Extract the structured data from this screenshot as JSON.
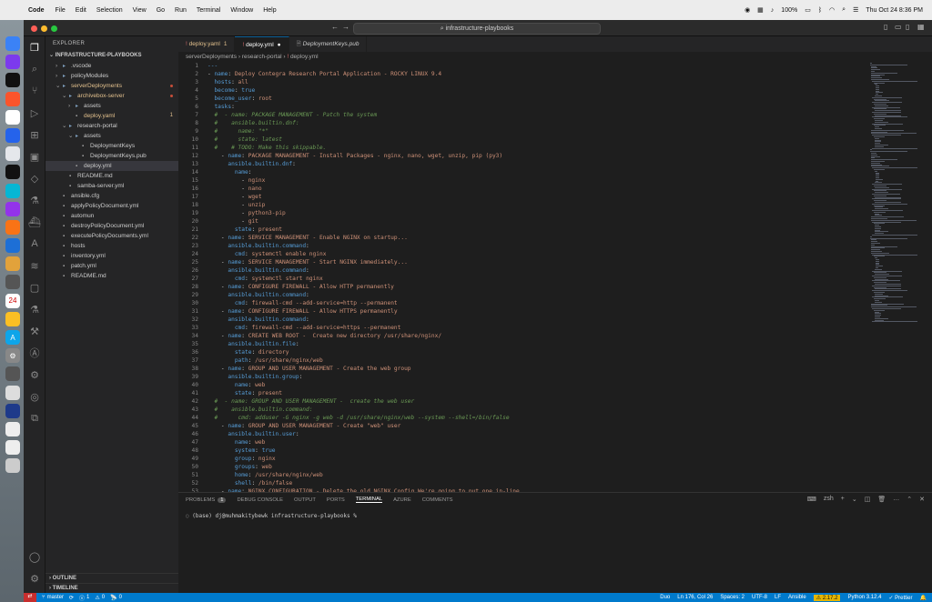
{
  "menubar": {
    "app": "Code",
    "items": [
      "File",
      "Edit",
      "Selection",
      "View",
      "Go",
      "Run",
      "Terminal",
      "Window",
      "Help"
    ],
    "battery": "100%",
    "datetime": "Thu Oct 24  8:36 PM"
  },
  "window": {
    "command_center": "infrastructure-playbooks"
  },
  "sidebar": {
    "header": "EXPLORER",
    "root": "INFRASTRUCTURE-PLAYBOOKS",
    "items": [
      {
        "label": ".vscode",
        "depth": 1,
        "kind": "folder",
        "open": false
      },
      {
        "label": "policyModules",
        "depth": 1,
        "kind": "folder",
        "open": false
      },
      {
        "label": "serverDeployments",
        "depth": 1,
        "kind": "folder",
        "open": true,
        "status": "modified"
      },
      {
        "label": "archivebox-server",
        "depth": 2,
        "kind": "folder",
        "open": true,
        "status": "modified"
      },
      {
        "label": "assets",
        "depth": 3,
        "kind": "folder",
        "open": false
      },
      {
        "label": "deploy.yaml",
        "depth": 3,
        "kind": "file",
        "status": "modified",
        "badge": "1"
      },
      {
        "label": "research-portal",
        "depth": 2,
        "kind": "folder",
        "open": true
      },
      {
        "label": "assets",
        "depth": 3,
        "kind": "folder",
        "open": true
      },
      {
        "label": "DeploymentKeys",
        "depth": 4,
        "kind": "file"
      },
      {
        "label": "DeploymentKeys.pub",
        "depth": 4,
        "kind": "file"
      },
      {
        "label": "deploy.yml",
        "depth": 3,
        "kind": "file",
        "selected": true
      },
      {
        "label": "README.md",
        "depth": 2,
        "kind": "file"
      },
      {
        "label": "samba-server.yml",
        "depth": 2,
        "kind": "file"
      },
      {
        "label": "ansible.cfg",
        "depth": 1,
        "kind": "file"
      },
      {
        "label": "applyPolicyDocument.yml",
        "depth": 1,
        "kind": "file"
      },
      {
        "label": "automun",
        "depth": 1,
        "kind": "file"
      },
      {
        "label": "destroyPolicyDocument.yml",
        "depth": 1,
        "kind": "file"
      },
      {
        "label": "executePolicyDocuments.yml",
        "depth": 1,
        "kind": "file"
      },
      {
        "label": "hosts",
        "depth": 1,
        "kind": "file"
      },
      {
        "label": "inventory.yml",
        "depth": 1,
        "kind": "file"
      },
      {
        "label": "patch.yml",
        "depth": 1,
        "kind": "file"
      },
      {
        "label": "README.md",
        "depth": 1,
        "kind": "file"
      }
    ],
    "outline": "OUTLINE",
    "timeline": "TIMELINE"
  },
  "tabs": [
    {
      "label": "deploy.yaml",
      "suffix": "1",
      "active": false,
      "modified": true
    },
    {
      "label": "deploy.yml",
      "suffix": "●",
      "active": true
    },
    {
      "label": "DeploymentKeys.pub",
      "suffix": "",
      "active": false
    }
  ],
  "breadcrumb": [
    "serverDeployments",
    "research-portal",
    "deploy.yml"
  ],
  "code_lines": [
    "---",
    "- name: Deploy Contegra Research Portal Application - ROCKY LINUX 9.4",
    "  hosts: all",
    "  become: true",
    "  become_user: root",
    "  tasks:",
    "  #  - name: PACKAGE MANAGEMENT - Patch the system",
    "  #    ansible.builtin.dnf:",
    "  #      name: \"*\"",
    "  #      state: latest",
    "  #    # TODO: Make this skippable.",
    "    - name: PACKAGE MANAGEMENT - Install Packages - nginx, nano, wget, unzip, pip (py3)",
    "      ansible.builtin.dnf:",
    "        name:",
    "          - nginx",
    "          - nano",
    "          - wget",
    "          - unzip",
    "          - python3-pip",
    "          - git",
    "        state: present",
    "    - name: SERVICE MANAGEMENT - Enable NGINX on startup...",
    "      ansible.builtin.command:",
    "        cmd: systemctl enable nginx",
    "    - name: SERVICE MANAGEMENT - Start NGINX immediately...",
    "      ansible.builtin.command:",
    "        cmd: systemctl start nginx",
    "    - name: CONFIGURE FIREWALL - Allow HTTP permanently",
    "      ansible.builtin.command:",
    "        cmd: firewall-cmd --add-service=http --permanent",
    "    - name: CONFIGURE FIREWALL - Allow HTTPS permanently",
    "      ansible.builtin.command:",
    "        cmd: firewall-cmd --add-service=https --permanent",
    "    - name: CREATE WEB ROOT -  Create new directory /usr/share/nginx/",
    "      ansible.builtin.file:",
    "        state: directory",
    "        path: /usr/share/nginx/web",
    "    - name: GROUP AND USER MANAGEMENT - Create the web group",
    "      ansible.builtin.group:",
    "        name: web",
    "        state: present",
    "  #  - name: GROUP AND USER MANAGEMENT -  create the web user",
    "  #    ansible.builtin.command:",
    "  #      cmd: adduser -G nginx -g web -d /usr/share/nginx/web --system --shell=/bin/false",
    "    - name: GROUP AND USER MANAGEMENT - Create \"web\" user",
    "      ansible.builtin.user:",
    "        name: web",
    "        system: true",
    "        group: nginx",
    "        groups: web",
    "        home: /usr/share/nginx/web",
    "        shell: /bin/false",
    "    - name: NGINX CONFIGURATION - Delete the old NGINX Config We're going to put one in-line"
  ],
  "panel": {
    "tabs": [
      "PROBLEMS",
      "DEBUG CONSOLE",
      "OUTPUT",
      "PORTS",
      "TERMINAL",
      "AZURE",
      "COMMENTS"
    ],
    "problems_count": "1",
    "active_tab": "TERMINAL",
    "shell": "zsh",
    "prompt": "(base) dj@muhmakitybewk infrastructure-playbooks %"
  },
  "statusbar": {
    "branch": "master",
    "errors": "1",
    "warnings": "0",
    "ports": "0",
    "duo": "Duo",
    "position": "Ln 176, Col 26",
    "spaces": "Spaces: 2",
    "encoding": "UTF-8",
    "eol": "LF",
    "language": "Ansible",
    "ansible_version": "2.17.2",
    "python": "Python 3.12.4",
    "prettier": "Prettier"
  }
}
